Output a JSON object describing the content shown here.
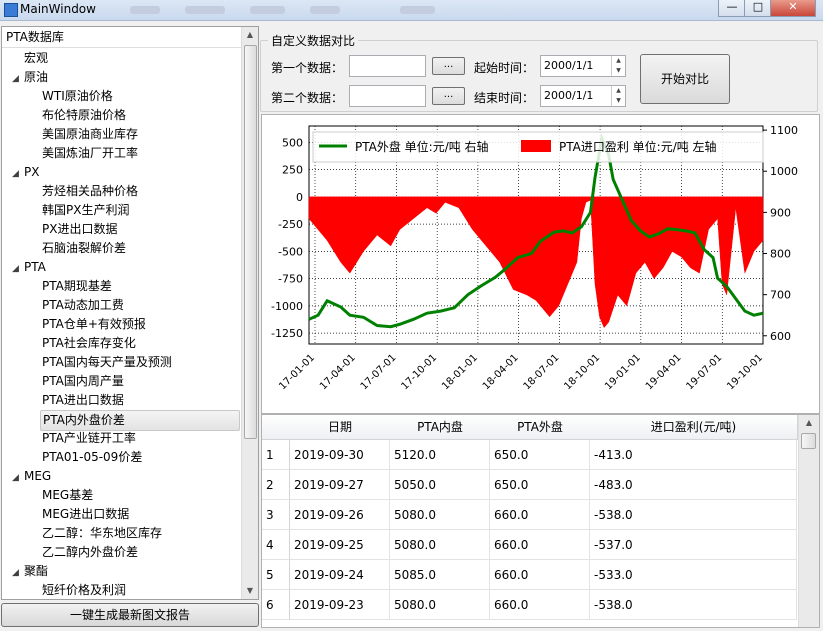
{
  "window": {
    "title": "MainWindow"
  },
  "tree": {
    "header": "PTA数据库",
    "items": [
      {
        "label": "宏观",
        "level": 0,
        "arrow": ""
      },
      {
        "label": "原油",
        "level": 0,
        "arrow": "◢"
      },
      {
        "label": "WTI原油价格",
        "level": 1,
        "arrow": ""
      },
      {
        "label": "布伦特原油价格",
        "level": 1,
        "arrow": ""
      },
      {
        "label": "美国原油商业库存",
        "level": 1,
        "arrow": ""
      },
      {
        "label": "美国炼油厂开工率",
        "level": 1,
        "arrow": ""
      },
      {
        "label": "PX",
        "level": 0,
        "arrow": "◢"
      },
      {
        "label": "芳烃相关品种价格",
        "level": 1,
        "arrow": ""
      },
      {
        "label": "韩国PX生产利润",
        "level": 1,
        "arrow": ""
      },
      {
        "label": "PX进出口数据",
        "level": 1,
        "arrow": ""
      },
      {
        "label": "石脑油裂解价差",
        "level": 1,
        "arrow": ""
      },
      {
        "label": "PTA",
        "level": 0,
        "arrow": "◢"
      },
      {
        "label": "PTA期现基差",
        "level": 1,
        "arrow": ""
      },
      {
        "label": "PTA动态加工费",
        "level": 1,
        "arrow": ""
      },
      {
        "label": "PTA仓单+有效预报",
        "level": 1,
        "arrow": ""
      },
      {
        "label": "PTA社会库存变化",
        "level": 1,
        "arrow": ""
      },
      {
        "label": "PTA国内每天产量及预测",
        "level": 1,
        "arrow": ""
      },
      {
        "label": "PTA国内周产量",
        "level": 1,
        "arrow": ""
      },
      {
        "label": "PTA进出口数据",
        "level": 1,
        "arrow": ""
      },
      {
        "label": "PTA内外盘价差",
        "level": 1,
        "arrow": "",
        "selected": true
      },
      {
        "label": "PTA产业链开工率",
        "level": 1,
        "arrow": ""
      },
      {
        "label": "PTA01-05-09价差",
        "level": 1,
        "arrow": ""
      },
      {
        "label": "MEG",
        "level": 0,
        "arrow": "◢"
      },
      {
        "label": "MEG基差",
        "level": 1,
        "arrow": ""
      },
      {
        "label": "MEG进出口数据",
        "level": 1,
        "arrow": ""
      },
      {
        "label": "乙二醇：华东地区库存",
        "level": 1,
        "arrow": ""
      },
      {
        "label": "乙二醇内外盘价差",
        "level": 1,
        "arrow": ""
      },
      {
        "label": "聚酯",
        "level": 0,
        "arrow": "◢"
      },
      {
        "label": "短纤价格及利润",
        "level": 1,
        "arrow": ""
      }
    ]
  },
  "generate_button": "一键生成最新图文报告",
  "compare": {
    "title": "自定义数据对比",
    "first_label": "第一个数据：",
    "second_label": "第二个数据：",
    "first_value": "",
    "second_value": "",
    "browse_label": "...",
    "start_label": "起始时间：",
    "end_label": "结束时间：",
    "start_date": "2000/1/1",
    "end_date": "2000/1/1",
    "run_button": "开始对比"
  },
  "chart_data": {
    "type": "line",
    "x_ticks": [
      "17-01-01",
      "17-04-01",
      "17-07-01",
      "17-10-01",
      "18-01-01",
      "18-04-01",
      "18-07-01",
      "18-10-01",
      "19-01-01",
      "19-04-01",
      "19-07-01",
      "19-10-01"
    ],
    "y_left_ticks": [
      500,
      250,
      0,
      -250,
      -500,
      -750,
      -1000,
      -1250
    ],
    "y_left_range": [
      -1350,
      650
    ],
    "y_right_ticks": [
      1100,
      1000,
      900,
      800,
      700,
      600
    ],
    "y_right_range": [
      580,
      1110
    ],
    "grid": true,
    "legend_position": "top",
    "series": [
      {
        "name": "PTA外盘  单位:元/吨  右轴",
        "axis": "right",
        "kind": "line",
        "color": "#008000",
        "x": [
          0,
          0.02,
          0.04,
          0.07,
          0.09,
          0.12,
          0.15,
          0.18,
          0.2,
          0.23,
          0.26,
          0.29,
          0.32,
          0.35,
          0.38,
          0.41,
          0.43,
          0.46,
          0.49,
          0.51,
          0.54,
          0.56,
          0.58,
          0.6,
          0.62,
          0.63,
          0.645,
          0.66,
          0.67,
          0.69,
          0.71,
          0.73,
          0.75,
          0.77,
          0.79,
          0.81,
          0.83,
          0.85,
          0.87,
          0.89,
          0.9,
          0.92,
          0.94,
          0.96,
          0.98,
          1.0
        ],
        "y": [
          640,
          650,
          685,
          670,
          650,
          645,
          625,
          622,
          628,
          640,
          655,
          660,
          668,
          700,
          722,
          742,
          760,
          790,
          800,
          830,
          852,
          855,
          850,
          865,
          900,
          985,
          1080,
          1040,
          980,
          930,
          880,
          855,
          840,
          848,
          860,
          858,
          855,
          850,
          810,
          790,
          740,
          720,
          690,
          660,
          650,
          655
        ]
      },
      {
        "name": "PTA进口盈利  单位:元/吨  左轴",
        "axis": "left",
        "kind": "area",
        "color": "#ff0000",
        "x": [
          0,
          0.02,
          0.04,
          0.07,
          0.09,
          0.12,
          0.15,
          0.18,
          0.2,
          0.23,
          0.26,
          0.28,
          0.3,
          0.33,
          0.36,
          0.39,
          0.42,
          0.45,
          0.48,
          0.5,
          0.53,
          0.55,
          0.57,
          0.59,
          0.6,
          0.61,
          0.62,
          0.63,
          0.64,
          0.65,
          0.66,
          0.68,
          0.7,
          0.72,
          0.74,
          0.76,
          0.78,
          0.8,
          0.82,
          0.84,
          0.86,
          0.88,
          0.9,
          0.91,
          0.92,
          0.94,
          0.96,
          0.98,
          1.0
        ],
        "y": [
          -200,
          -300,
          -400,
          -600,
          -700,
          -500,
          -350,
          -450,
          -300,
          -200,
          -100,
          -150,
          -50,
          -100,
          -300,
          -450,
          -600,
          -850,
          -900,
          -950,
          -1100,
          -1000,
          -800,
          -600,
          -200,
          -50,
          -30,
          -800,
          -1100,
          -1200,
          -1150,
          -900,
          -1000,
          -700,
          -600,
          -750,
          -650,
          -500,
          -550,
          -650,
          -700,
          -300,
          -200,
          -800,
          -900,
          -100,
          -700,
          -500,
          -400
        ]
      }
    ]
  },
  "table": {
    "columns": [
      "日期",
      "PTA内盘",
      "PTA外盘",
      "进口盈利(元/吨)"
    ],
    "rows": [
      {
        "n": "1",
        "date": "2019-09-30",
        "inner": "5120.0",
        "outer": "650.0",
        "profit": "-413.0"
      },
      {
        "n": "2",
        "date": "2019-09-27",
        "inner": "5050.0",
        "outer": "650.0",
        "profit": "-483.0"
      },
      {
        "n": "3",
        "date": "2019-09-26",
        "inner": "5080.0",
        "outer": "660.0",
        "profit": "-538.0"
      },
      {
        "n": "4",
        "date": "2019-09-25",
        "inner": "5080.0",
        "outer": "660.0",
        "profit": "-537.0"
      },
      {
        "n": "5",
        "date": "2019-09-24",
        "inner": "5085.0",
        "outer": "660.0",
        "profit": "-533.0"
      },
      {
        "n": "6",
        "date": "2019-09-23",
        "inner": "5080.0",
        "outer": "660.0",
        "profit": "-538.0"
      }
    ]
  }
}
